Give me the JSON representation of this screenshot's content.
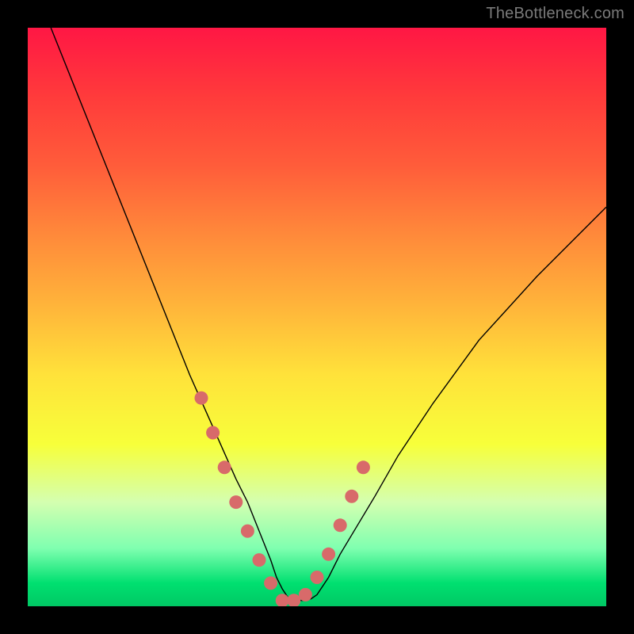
{
  "watermark": "TheBottleneck.com",
  "chart_data": {
    "type": "line",
    "title": "",
    "xlabel": "",
    "ylabel": "",
    "xlim": [
      0,
      100
    ],
    "ylim": [
      0,
      100
    ],
    "curve": {
      "x": [
        4,
        8,
        12,
        16,
        20,
        24,
        28,
        32,
        36,
        38,
        40,
        42,
        43,
        44,
        45,
        46,
        47,
        48,
        49,
        50,
        52,
        54,
        57,
        60,
        64,
        70,
        78,
        88,
        100
      ],
      "y": [
        100,
        90,
        80,
        70,
        60,
        50,
        40,
        31,
        22,
        18,
        13,
        8,
        5,
        3,
        1.5,
        1,
        1,
        1,
        1.3,
        2,
        5,
        9,
        14,
        19,
        26,
        35,
        46,
        57,
        69
      ]
    },
    "points": {
      "x": [
        30,
        32,
        34,
        36,
        38,
        40,
        42,
        44,
        46,
        48,
        50,
        52,
        54,
        56,
        58
      ],
      "y": [
        36,
        30,
        24,
        18,
        13,
        8,
        4,
        1,
        1,
        2,
        5,
        9,
        14,
        19,
        24
      ]
    }
  }
}
